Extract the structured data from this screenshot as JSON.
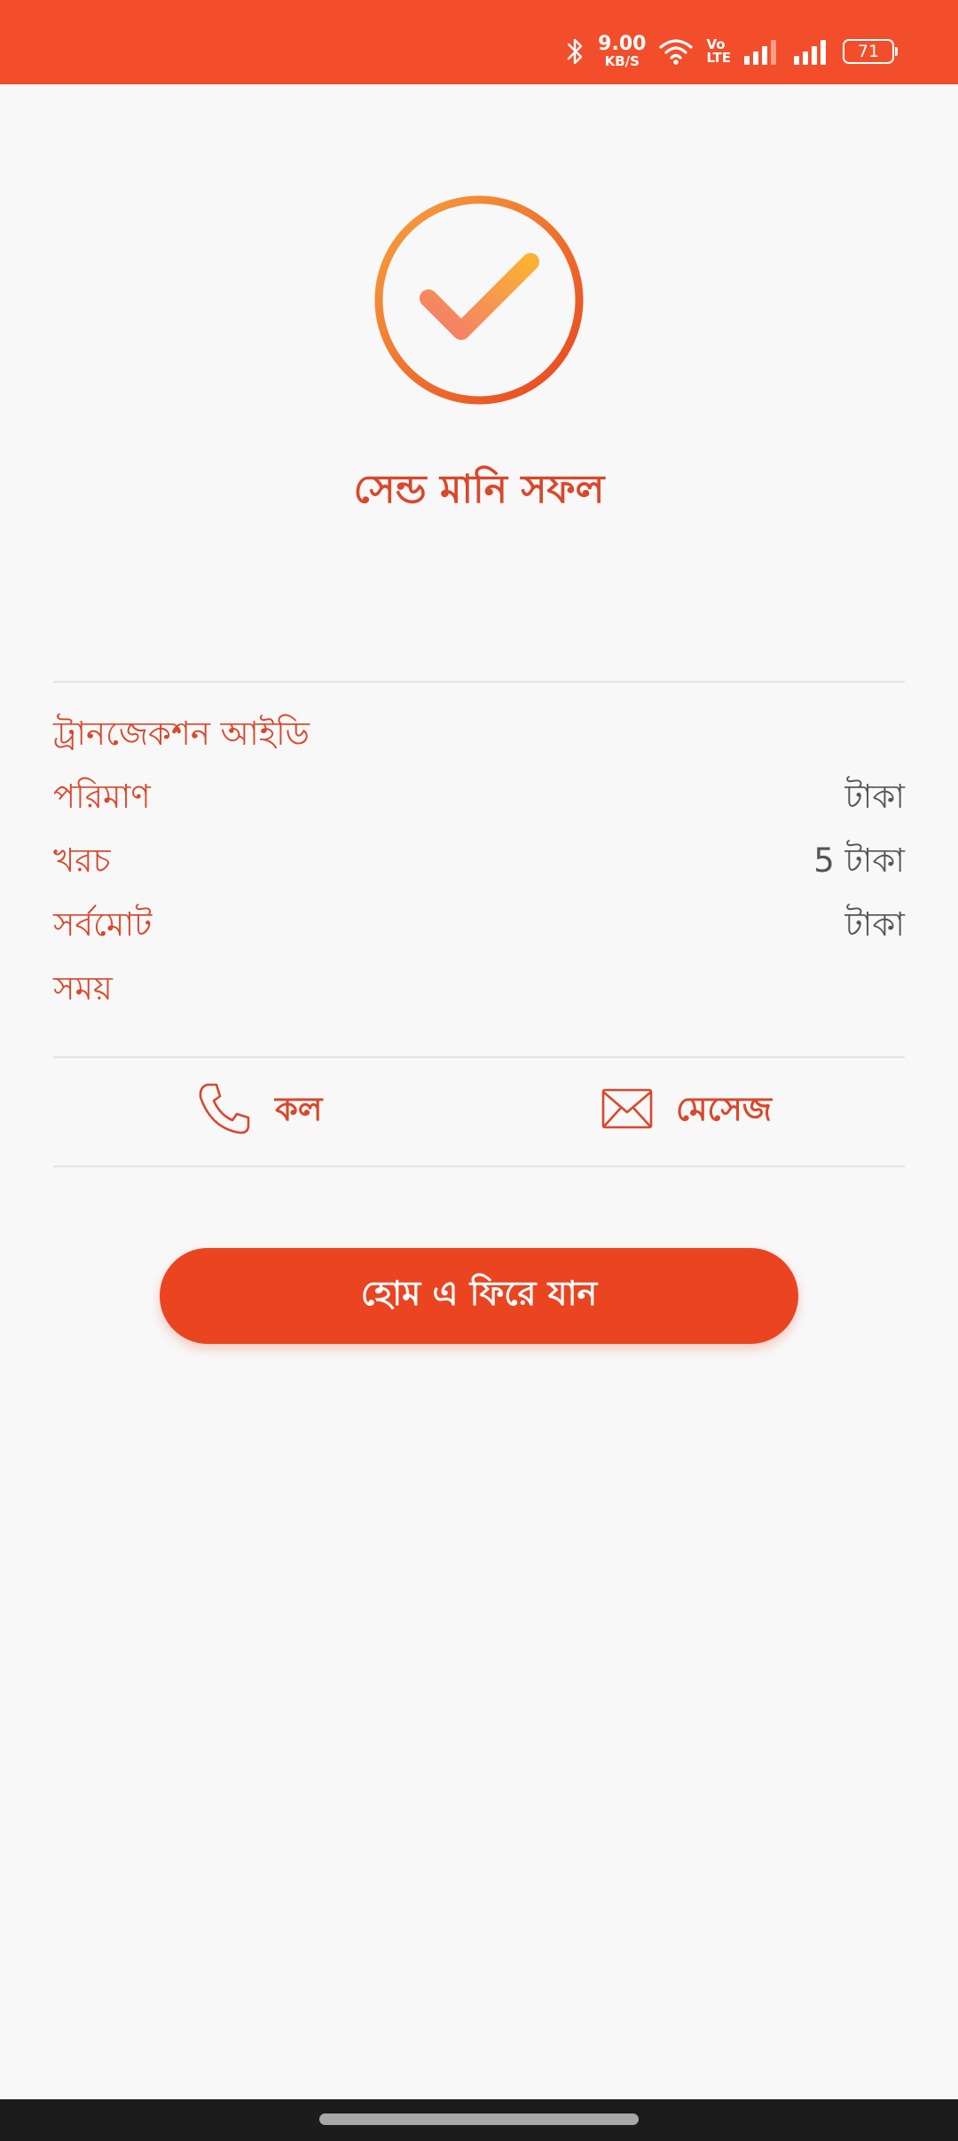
{
  "status_bar": {
    "speed_value": "9.00",
    "speed_unit": "KB/S",
    "volte_top": "Vo",
    "volte_bottom": "LTE",
    "battery_level": "71",
    "icons": [
      "bluetooth-icon",
      "wifi-icon",
      "volte-icon",
      "signal-icon",
      "signal-icon",
      "battery-icon"
    ]
  },
  "success": {
    "icon": "check-circle-icon",
    "title": "সেন্ড মানি সফল"
  },
  "details": {
    "transaction_id": {
      "label": "ট্রানজেকশন আইডি",
      "value": ""
    },
    "amount": {
      "label": "পরিমাণ",
      "value": "টাকা"
    },
    "charge": {
      "label": "খরচ",
      "value": "5 টাকা"
    },
    "total": {
      "label": "সর্বমোট",
      "value": "টাকা"
    },
    "time": {
      "label": "সময়",
      "value": ""
    }
  },
  "actions": {
    "call_label": "কল",
    "message_label": "মেসেজ"
  },
  "home_button_label": "হোম এ ফিরে যান",
  "colors": {
    "status_bar": "#f24e2b",
    "accent": "#d9482c",
    "button": "#ea4420",
    "background": "#f8f8f8"
  }
}
